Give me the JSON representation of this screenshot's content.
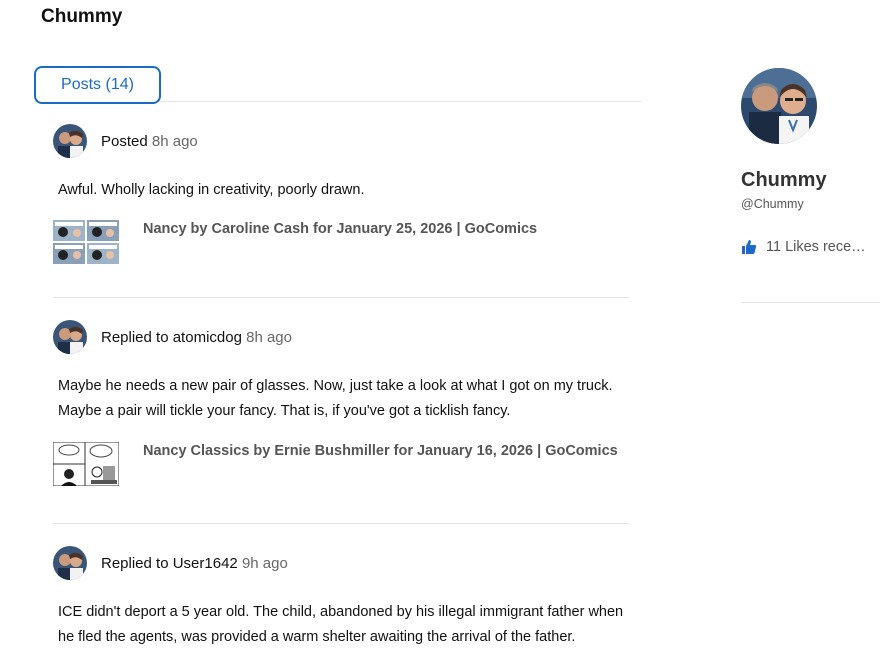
{
  "page": {
    "title": "Chummy"
  },
  "tabs": [
    {
      "label": "Posts (14)"
    }
  ],
  "posts": [
    {
      "action": "Posted",
      "target": "",
      "time": "8h ago",
      "body": "Awful. Wholly lacking in creativity, poorly drawn.",
      "card": {
        "title": "Nancy by Caroline Cash for January 25, 2026 | GoComics"
      }
    },
    {
      "action": "Replied to",
      "target": "atomicdog",
      "time": "8h ago",
      "body": "Maybe he needs a new pair of glasses. Now, just take a look at what I got on my truck. Maybe a pair will tickle your fancy. That is, if you've got a ticklish fancy.",
      "card": {
        "title": "Nancy Classics by Ernie Bushmiller for January 16, 2026 | GoComics"
      }
    },
    {
      "action": "Replied to",
      "target": "User1642",
      "time": "9h ago",
      "body": "ICE didn't deport a 5 year old. The child, abandoned by his illegal immigrant father when he fled the agents, was provided a warm shelter awaiting the arrival of the father."
    }
  ],
  "sidebar": {
    "name": "Chummy",
    "handle": "@Chummy",
    "likes": "11 Likes rece…"
  },
  "colors": {
    "accent": "#1b6ac9",
    "divider": "#e3e3e3"
  }
}
